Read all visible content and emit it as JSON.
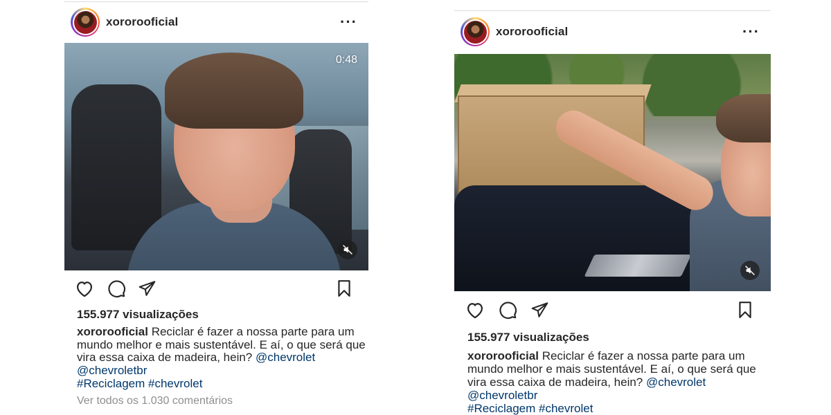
{
  "colors": {
    "text": "#262626",
    "link": "#00376b",
    "muted": "#8e8e8e",
    "story_ring": "#d62976"
  },
  "posts": [
    {
      "username": "xororooficial",
      "video_duration": "0:48",
      "views": "155.977 visualizações",
      "caption": {
        "user": "xororooficial",
        "text_line1": " Reciclar é fazer a nossa parte para um",
        "text_line2": "mundo melhor e mais sustentável. E aí, o que será que",
        "text_line3_plain": "vira essa caixa de madeira, hein? ",
        "mention1": "@chevrolet",
        "mention2": "@chevroletbr",
        "hashtag1": "#Reciclagem",
        "hashtag2": "#chevrolet"
      },
      "comments_link": "Ver todos os 1.030 comentários"
    },
    {
      "username": "xororooficial",
      "views": "155.977 visualizações",
      "caption": {
        "user": "xororooficial",
        "text_line1": " Reciclar é fazer a nossa parte para um",
        "text_line2": "mundo melhor e mais sustentável. E aí, o que será que",
        "text_line3_plain": "vira essa caixa de madeira, hein? ",
        "mention1": "@chevrolet",
        "mention2": "@chevroletbr",
        "hashtag1": "#Reciclagem",
        "hashtag2": "#chevrolet"
      }
    }
  ],
  "icons": {
    "more": "more-options-icon",
    "like": "heart-icon",
    "comment": "comment-icon",
    "share": "share-icon",
    "save": "bookmark-icon",
    "mute": "muted-speaker-icon"
  }
}
